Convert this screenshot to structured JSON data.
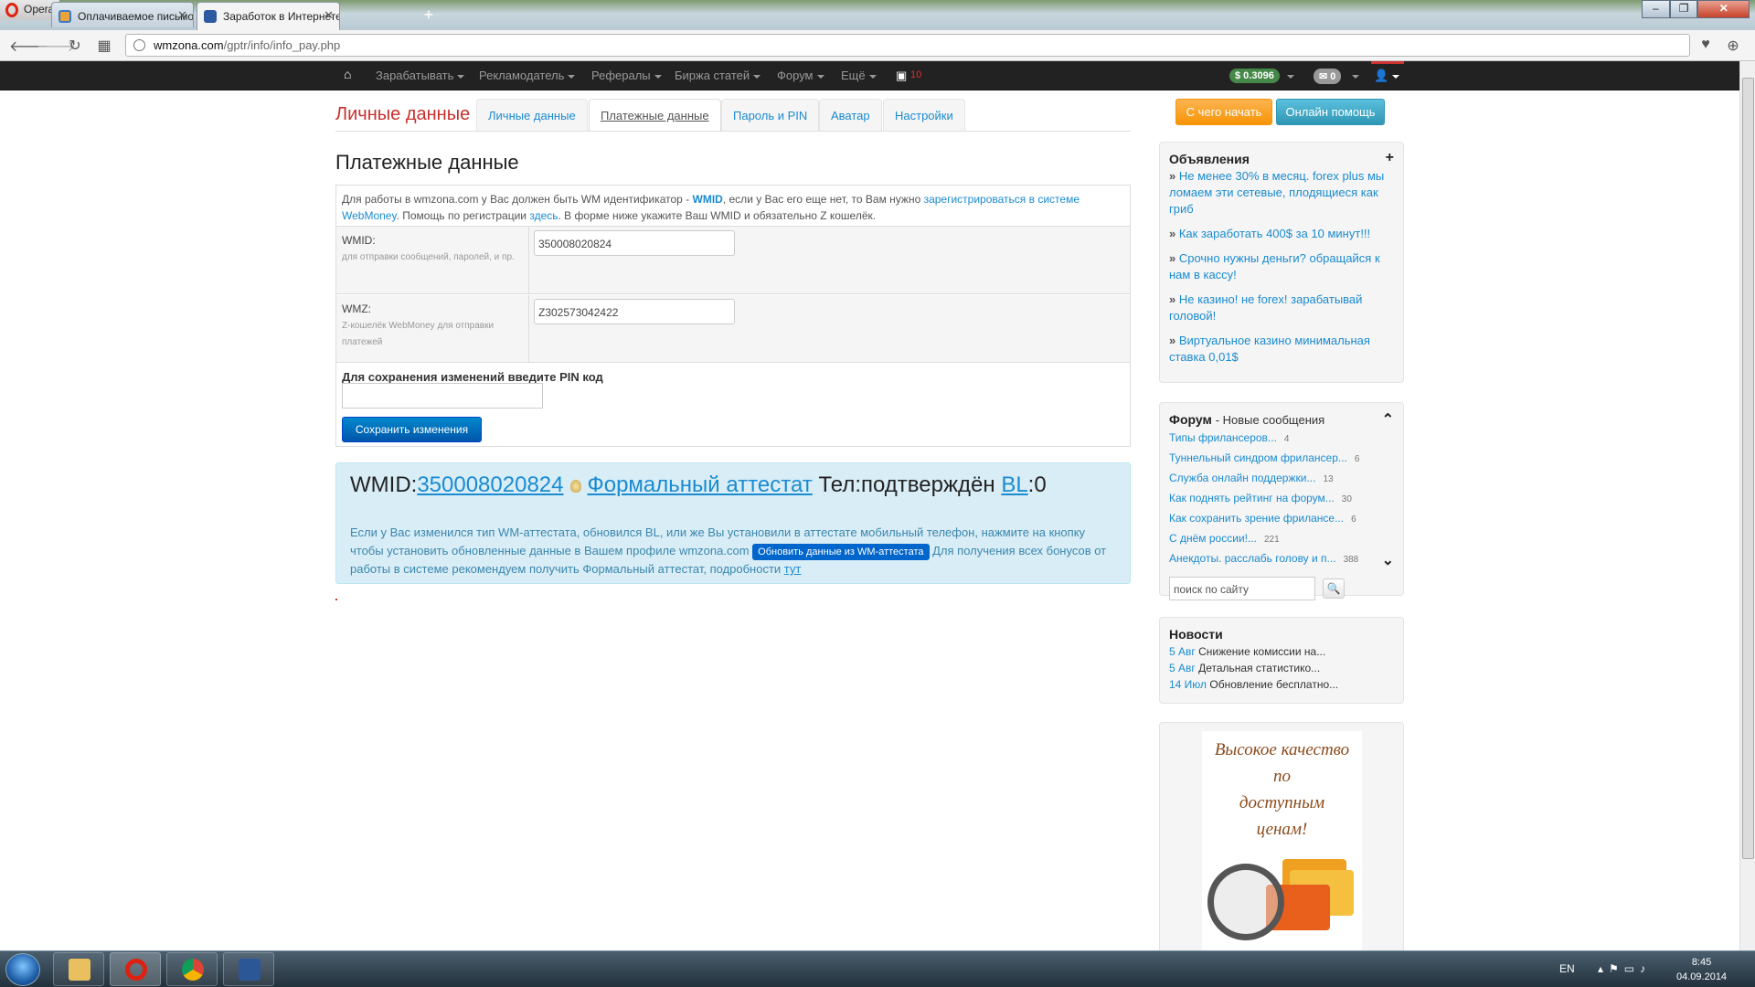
{
  "browser": {
    "opera_label": "Opera",
    "tabs": [
      {
        "title": "Оплачиваемое письмо W"
      },
      {
        "title": "Заработок в Интернете |"
      }
    ],
    "new_tab": "+",
    "window_controls": {
      "minimize": "–",
      "maximize": "❐",
      "close": "✕"
    },
    "url_host": "wmzona.com",
    "url_path": "/gptr/info/info_pay.php"
  },
  "sitenav": {
    "home_icon": "home-icon",
    "items": [
      {
        "label": "Зарабатывать"
      },
      {
        "label": "Рекламодатель"
      },
      {
        "label": "Рефералы"
      },
      {
        "label": "Биржа статей"
      },
      {
        "label": "Форум"
      },
      {
        "label": "Ещё"
      }
    ],
    "notify_count": "10",
    "balance": "$ 0.3096",
    "mail_count": "0"
  },
  "page": {
    "section_title": "Личные данные",
    "tabs": [
      {
        "label": "Личные данные"
      },
      {
        "label": "Платежные данные"
      },
      {
        "label": "Пароль и PIN"
      },
      {
        "label": "Аватар"
      },
      {
        "label": "Настройки"
      }
    ],
    "heading": "Платежные данные",
    "intro": {
      "t1": "Для работы в wmzona.com у Вас должен быть WM идентификатор - ",
      "wmid_link": "WMID",
      "t2": ", если у Вас его еще нет, то Вам нужно ",
      "reg_link": "зарегистрироваться в системе WebMoney",
      "t3": ". Помощь по регистрации ",
      "here_link": "здесь",
      "t4": ". В форме ниже укажите Ваш WMID и обязательно Z кошелёк."
    },
    "wmid_field": {
      "label": "WMID:",
      "hint": "для отправки сообщений, паролей, и пр.",
      "value": "350008020824"
    },
    "wmz_field": {
      "label": "WMZ:",
      "hint": "Z-кошелёк WebMoney для отправки платежей",
      "value": "Z302573042422"
    },
    "pin_label": "Для сохранения изменений введите PIN код",
    "save_button": "Сохранить изменения",
    "wm_info": {
      "wmid_prefix": "WMID:",
      "wmid_value": "350008020824",
      "attestat": "Формальный аттестат",
      "phone": "Тел:подтверждён",
      "bl_link": "BL",
      "bl_value": ":0",
      "text1": "Если у Вас изменился тип WM-аттестата, обновился BL, или же Вы установили в аттестате мобильный телефон, нажмите на кнопку чтобы установить обновленные данные в Вашем профиле wmzona.com ",
      "update_button": "Обновить данные из WM-аттестата",
      "text2": " Для получения всех бонусов от работы в системе рекомендуем получить Формальный аттестат, подробности ",
      "here_link": "тут"
    }
  },
  "sidebar": {
    "start_button": "С чего начать",
    "help_button": "Онлайн помощь",
    "ads": {
      "title": "Объявления",
      "add_icon": "+",
      "items": [
        {
          "text": "Не менее 30% в месяц. forex plus мы ломаем эти сетевые, плодящиеся как гриб"
        },
        {
          "text": "Как заработать 400$ за 10 минут!!!"
        },
        {
          "text": "Срочно нужны деньги? обращайся к нам в кассу!"
        },
        {
          "text": "Не казино! не forex! зарабатывай головой!"
        },
        {
          "text": "Виртуальное казино минимальная ставка 0,01$"
        }
      ]
    },
    "forum": {
      "title": "Форум",
      "subtitle": "- Новые сообщения",
      "items": [
        {
          "title": "Типы фрилансеров...",
          "count": "4"
        },
        {
          "title": "Туннельный синдром фрилансер...",
          "count": "6"
        },
        {
          "title": "Служба онлайн поддержки...",
          "count": "13"
        },
        {
          "title": "Как поднять рейтинг на форум...",
          "count": "30"
        },
        {
          "title": "Как сохранить зрение фрилансе...",
          "count": "6"
        },
        {
          "title": "С днём россии!...",
          "count": "221"
        },
        {
          "title": "Анекдоты. расслабь голову и п...",
          "count": "388"
        }
      ],
      "search_placeholder": "поиск по сайту"
    },
    "news": {
      "title": "Новости",
      "items": [
        {
          "date": "5 Авг",
          "text": "Снижение комиссии на..."
        },
        {
          "date": "5 Авг",
          "text": "Детальная статистико..."
        },
        {
          "date": "14 Июл",
          "text": "Обновление бесплатно..."
        }
      ]
    },
    "ad_banner": {
      "line1": "Высокое качество",
      "line2": "по",
      "line3": "доступным",
      "line4": "ценам!"
    }
  },
  "taskbar": {
    "lang": "EN",
    "time": "8:45",
    "date": "04.09.2014"
  }
}
